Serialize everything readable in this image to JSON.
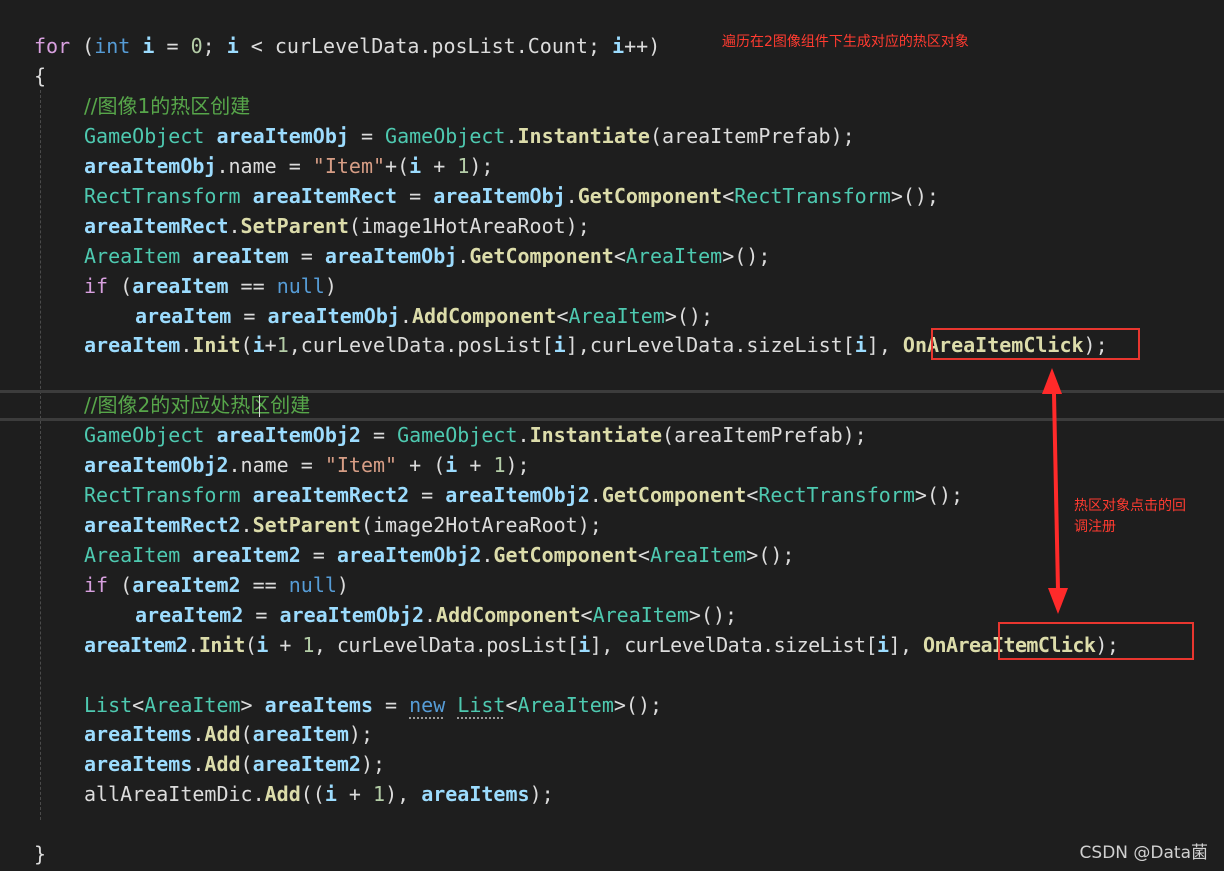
{
  "code": {
    "l1": [
      "for",
      "int",
      "i",
      "0",
      "i",
      "curLevelData",
      "posList",
      "Count",
      "i"
    ],
    "l2": "{",
    "comment1": "//图像1的热区创建",
    "l4": [
      "GameObject",
      "areaItemObj",
      "GameObject",
      "Instantiate",
      "areaItemPrefab"
    ],
    "l5": [
      "areaItemObj",
      "name",
      "\"Item\"",
      "i",
      "1"
    ],
    "l6": [
      "RectTransform",
      "areaItemRect",
      "areaItemObj",
      "GetComponent",
      "RectTransform"
    ],
    "l7": [
      "areaItemRect",
      "SetParent",
      "image1HotAreaRoot"
    ],
    "l8": [
      "AreaItem",
      "areaItem",
      "areaItemObj",
      "GetComponent",
      "AreaItem"
    ],
    "l9": [
      "if",
      "areaItem",
      "null"
    ],
    "l10": [
      "areaItem",
      "areaItemObj",
      "AddComponent",
      "AreaItem"
    ],
    "l11": [
      "areaItem",
      "Init",
      "i",
      "1",
      "curLevelData",
      "posList",
      "i",
      "curLevelData",
      "sizeList",
      "i",
      "OnAreaItemClick"
    ],
    "comment2a": "//图像2的对应处",
    "comment2b": "热区创建",
    "l14": [
      "GameObject",
      "areaItemObj2",
      "GameObject",
      "Instantiate",
      "areaItemPrefab"
    ],
    "l15": [
      "areaItemObj2",
      "name",
      "\"Item\"",
      "i",
      "1"
    ],
    "l16": [
      "RectTransform",
      "areaItemRect2",
      "areaItemObj2",
      "GetComponent",
      "RectTransform"
    ],
    "l17": [
      "areaItemRect2",
      "SetParent",
      "image2HotAreaRoot"
    ],
    "l18": [
      "AreaItem",
      "areaItem2",
      "areaItemObj2",
      "GetComponent",
      "AreaItem"
    ],
    "l19": [
      "if",
      "areaItem2",
      "null"
    ],
    "l20": [
      "areaItem2",
      "areaItemObj2",
      "AddComponent",
      "AreaItem"
    ],
    "l21": [
      "areaItem2",
      "Init",
      "i",
      "1",
      "curLevelData",
      "posList",
      "i",
      "curLevelData",
      "sizeList",
      "i",
      "OnAreaItemClick"
    ],
    "l23": [
      "List",
      "AreaItem",
      "areaItems",
      "new",
      "List",
      "AreaItem"
    ],
    "l24": [
      "areaItems",
      "Add",
      "areaItem"
    ],
    "l25": [
      "areaItems",
      "Add",
      "areaItem2"
    ],
    "l26": [
      "allAreaItemDic",
      "Add",
      "i",
      "1",
      "areaItems"
    ],
    "l28": "}"
  },
  "annotations": {
    "top": "遍历在2图像组件下生成对应的热区对象",
    "side_line1": "热区对象点击的回",
    "side_line2": "调注册"
  },
  "watermark": "CSDN @Data菌",
  "colors": {
    "background": "#1e1e1e",
    "keyword": "#569cd6",
    "type": "#4ec9b0",
    "method": "#dcdcaa",
    "variable": "#9cdcfe",
    "string": "#d69d85",
    "comment": "#57a64a",
    "annotation": "#ff3b30"
  },
  "icons": [
    "double-arrow-icon"
  ]
}
